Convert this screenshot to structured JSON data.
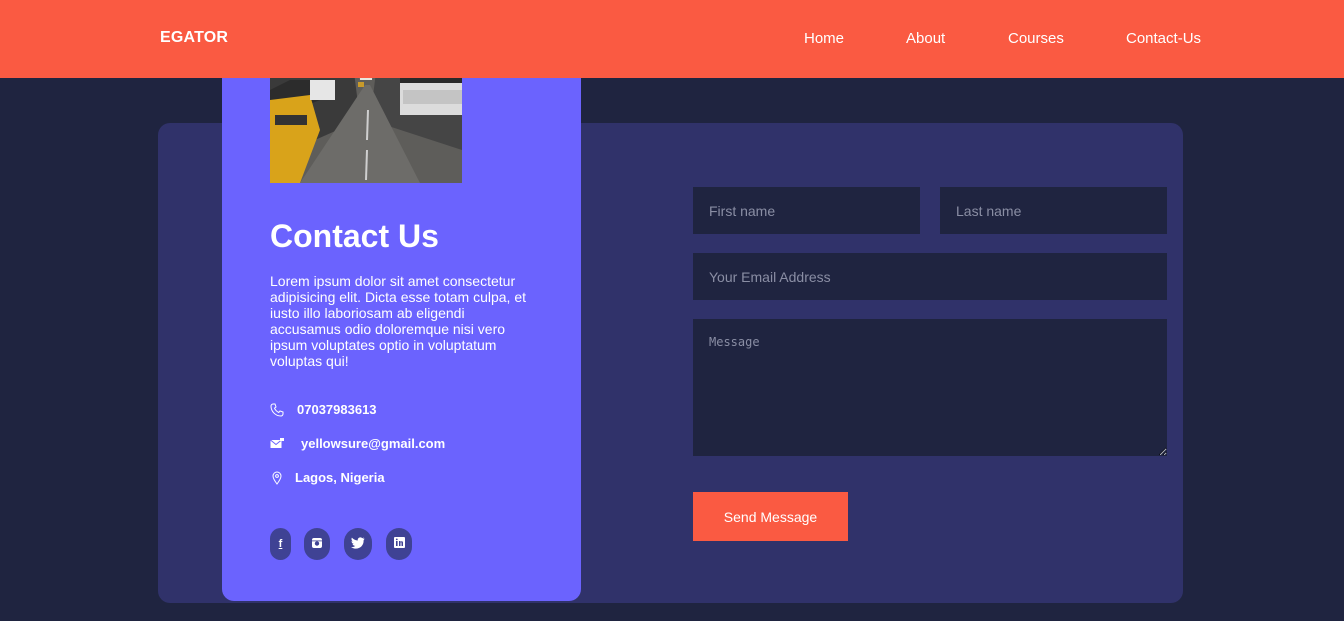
{
  "header": {
    "brand": "EGATOR",
    "nav": [
      "Home",
      "About",
      "Courses",
      "Contact-Us"
    ]
  },
  "contact": {
    "title": "Contact Us",
    "description": "Lorem ipsum dolor sit amet consectetur adipisicing elit. Dicta esse totam culpa, et iusto illo laboriosam ab eligendi accusamus odio doloremque nisi vero ipsum voluptates optio in voluptatum voluptas qui!",
    "phone": "07037983613",
    "email": "yellowsure@gmail.com",
    "location": "Lagos, Nigeria",
    "socials": [
      "facebook-icon",
      "instagram-icon",
      "twitter-icon",
      "linkedin-icon"
    ]
  },
  "form": {
    "first_name_placeholder": "First name",
    "last_name_placeholder": "Last name",
    "email_placeholder": "Your Email Address",
    "message_placeholder": "Message",
    "submit_label": "Send Message"
  },
  "colors": {
    "accent": "#fa5a42",
    "panel": "#6b63fe",
    "card": "#30326a",
    "background": "#1f2440"
  }
}
